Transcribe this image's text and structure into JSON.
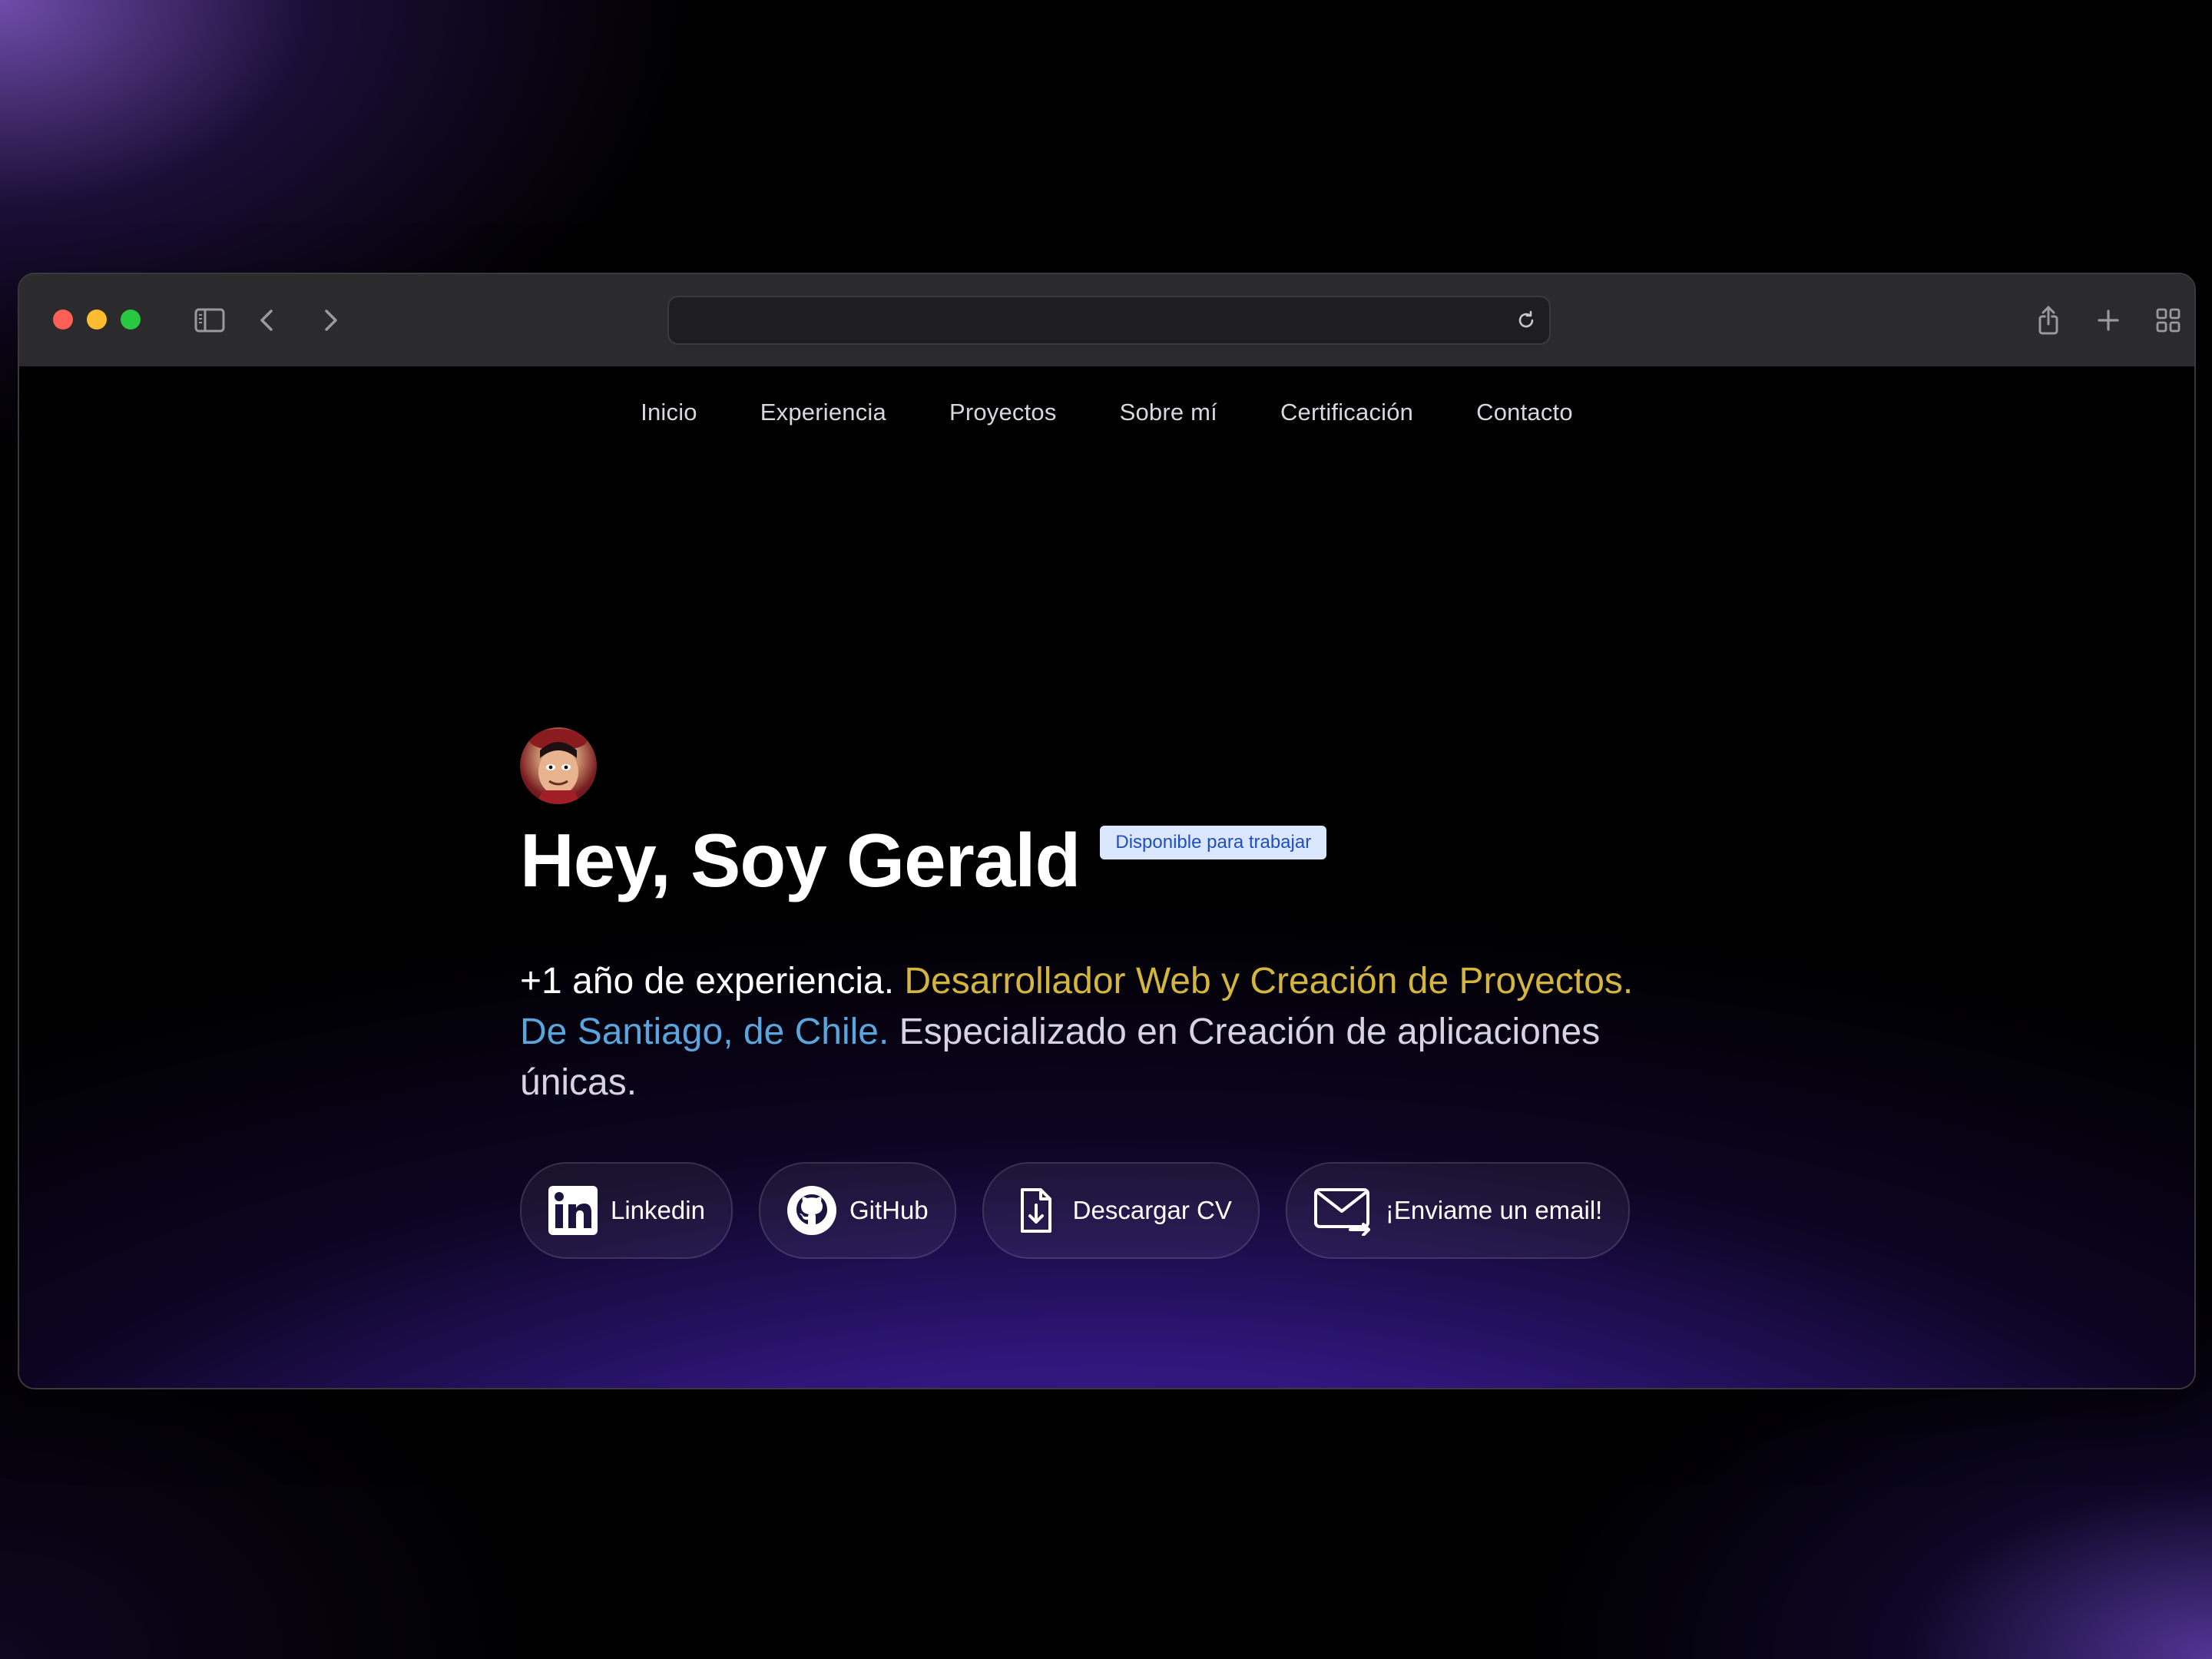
{
  "nav": {
    "items": [
      "Inicio",
      "Experiencia",
      "Proyectos",
      "Sobre mí",
      "Certificación",
      "Contacto"
    ]
  },
  "hero": {
    "title": "Hey, Soy Gerald",
    "badge": "Disponible para trabajar",
    "desc": {
      "part1": "+1 año de experiencia. ",
      "part2": "Desarrollador Web y Creación de Proyectos.",
      "part3": " De Santiago, de Chile.",
      "part4": " Especializado en Creación de aplicaciones únicas."
    }
  },
  "buttons": {
    "linkedin": "Linkedin",
    "github": "GitHub",
    "cv": "Descargar CV",
    "email": "¡Enviame un email!"
  },
  "colors": {
    "accent_gold": "#d4b53d",
    "accent_blue": "#58a6dd",
    "badge_bg": "#dbe6ff",
    "badge_text": "#1f4fbf",
    "gradient_purple": "#4b23af"
  },
  "icons": {
    "toolbar": [
      "sidebar-icon",
      "back-icon",
      "forward-icon",
      "reload-icon",
      "share-icon",
      "new-tab-icon",
      "tab-overview-icon"
    ],
    "buttons": [
      "linkedin-icon",
      "github-icon",
      "download-file-icon",
      "mail-send-icon"
    ]
  }
}
